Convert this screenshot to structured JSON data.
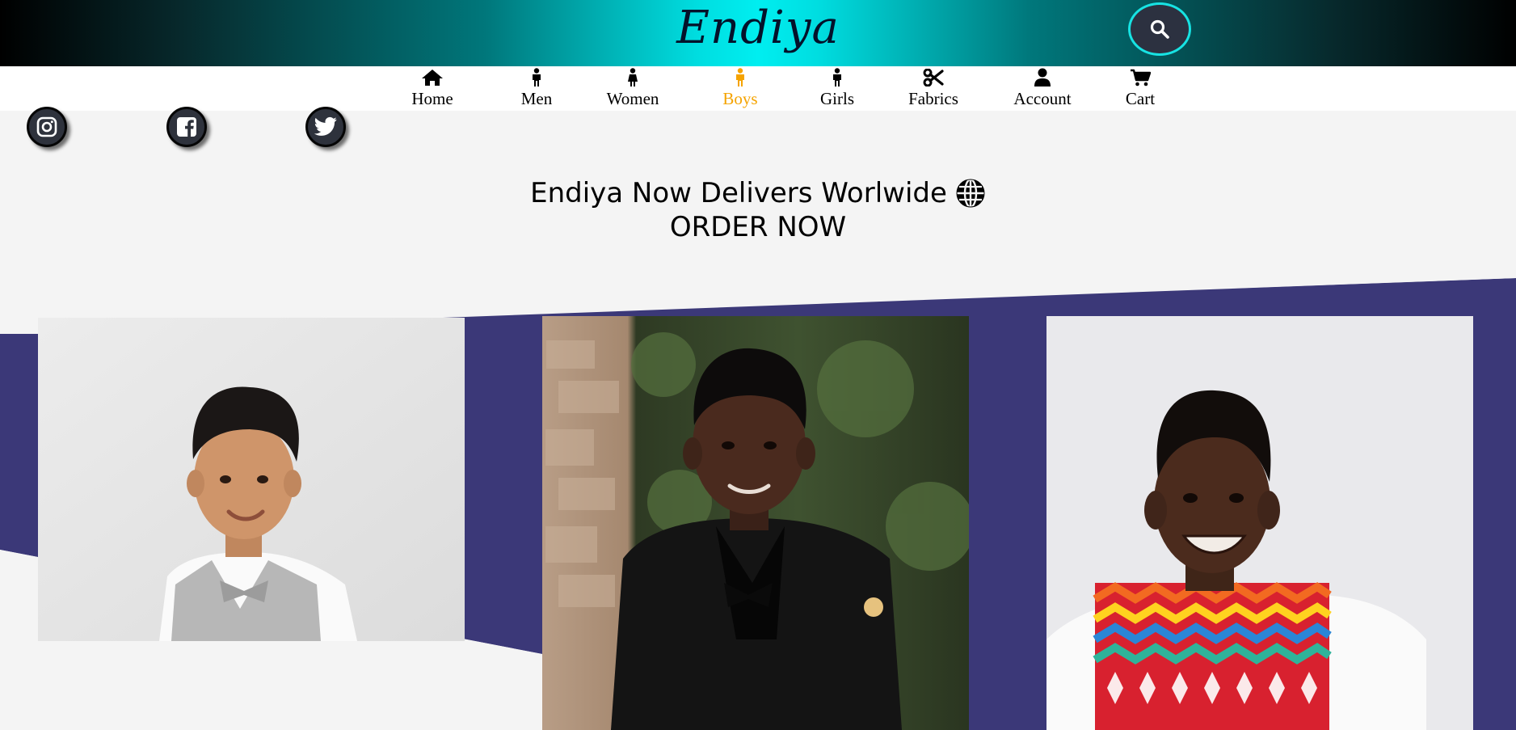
{
  "header": {
    "logo": "Endiya",
    "search_icon": "search-icon"
  },
  "nav": {
    "items": [
      {
        "label": "Home",
        "icon": "home-icon"
      },
      {
        "label": "Men",
        "icon": "man-icon"
      },
      {
        "label": "Women",
        "icon": "woman-icon"
      },
      {
        "label": "Boys",
        "icon": "boy-icon",
        "active": true
      },
      {
        "label": "Girls",
        "icon": "girl-icon"
      },
      {
        "label": "Fabrics",
        "icon": "scissors-icon"
      },
      {
        "label": "Account",
        "icon": "user-icon"
      },
      {
        "label": "Cart",
        "icon": "cart-icon"
      }
    ],
    "active_color": "#f5a300"
  },
  "social": [
    "instagram-icon",
    "facebook-icon",
    "twitter-icon"
  ],
  "announcement": {
    "line1": "Endiya Now Delivers Worlwide",
    "line1_icon": "globe-icon",
    "line2": "ORDER NOW"
  },
  "colors": {
    "accent_band": "#3b3878",
    "header_cyan": "#00eef0",
    "page_bg": "#f4f4f4"
  },
  "hero": {
    "photos": [
      {
        "name": "photo-boy-grey-vest"
      },
      {
        "name": "photo-boy-black-suit"
      },
      {
        "name": "photo-boy-african-print"
      }
    ]
  }
}
